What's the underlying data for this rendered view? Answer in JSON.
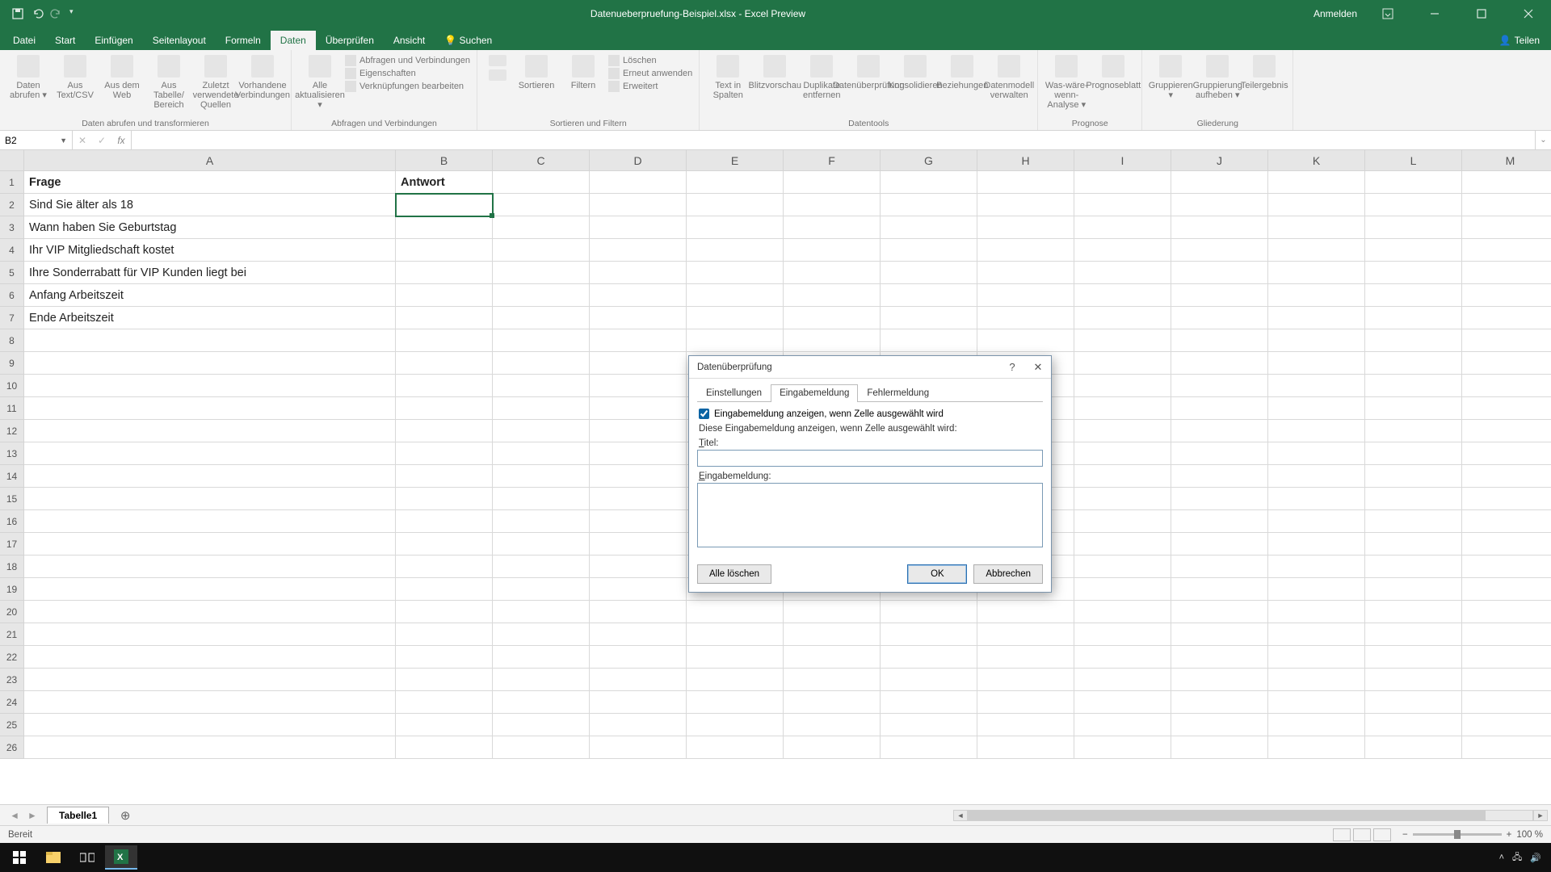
{
  "app": {
    "title": "Datenueberpruefung-Beispiel.xlsx - Excel Preview",
    "signin": "Anmelden"
  },
  "ribbon_tabs": [
    "Datei",
    "Start",
    "Einfügen",
    "Seitenlayout",
    "Formeln",
    "Daten",
    "Überprüfen",
    "Ansicht"
  ],
  "ribbon_search": "Suchen",
  "ribbon_share": "Teilen",
  "ribbon_active_tab": "Daten",
  "ribbon_groups": {
    "g1": {
      "label": "Daten abrufen und transformieren",
      "items": [
        "Daten abrufen ▾",
        "Aus Text/CSV",
        "Aus dem Web",
        "Aus Tabelle/ Bereich",
        "Zuletzt verwendete Quellen",
        "Vorhandene Verbindungen"
      ]
    },
    "g2": {
      "label": "Abfragen und Verbindungen",
      "big": "Alle aktualisieren ▾",
      "rows": [
        "Abfragen und Verbindungen",
        "Eigenschaften",
        "Verknüpfungen bearbeiten"
      ]
    },
    "g3": {
      "label": "Sortieren und Filtern",
      "items": [
        "Sortieren",
        "Filtern"
      ],
      "rows": [
        "Löschen",
        "Erneut anwenden",
        "Erweitert"
      ]
    },
    "g4": {
      "label": "Datentools",
      "items": [
        "Text in Spalten",
        "Blitzvorschau",
        "Duplikate entfernen",
        "Datenüberprüfung",
        "Konsolidieren",
        "Beziehungen",
        "Datenmodell verwalten"
      ]
    },
    "g5": {
      "label": "Prognose",
      "items": [
        "Was-wäre-wenn- Analyse ▾",
        "Prognoseblatt"
      ]
    },
    "g6": {
      "label": "Gliederung",
      "items": [
        "Gruppieren ▾",
        "Gruppierung aufheben ▾",
        "Teilergebnis"
      ]
    }
  },
  "namebox": "B2",
  "formula": "",
  "columns": [
    "A",
    "B",
    "C",
    "D",
    "E",
    "F",
    "G",
    "H",
    "I",
    "J",
    "K",
    "L",
    "M"
  ],
  "rows": {
    "1": {
      "A": "Frage",
      "B": "Antwort"
    },
    "2": {
      "A": "Sind Sie älter als 18"
    },
    "3": {
      "A": "Wann haben Sie Geburtstag"
    },
    "4": {
      "A": "Ihr VIP Mitgliedschaft kostet"
    },
    "5": {
      "A": "Ihre Sonderrabatt für VIP Kunden liegt bei"
    },
    "6": {
      "A": "Anfang Arbeitszeit"
    },
    "7": {
      "A": "Ende Arbeitszeit"
    }
  },
  "row_count": 26,
  "sheet_tab": "Tabelle1",
  "status": "Bereit",
  "zoom": "100 %",
  "dialog": {
    "title": "Datenüberprüfung",
    "tabs": [
      "Einstellungen",
      "Eingabemeldung",
      "Fehlermeldung"
    ],
    "active_tab": "Eingabemeldung",
    "checkbox": "Eingabemeldung anzeigen, wenn Zelle ausgewählt wird",
    "heading": "Diese Eingabemeldung anzeigen, wenn Zelle ausgewählt wird:",
    "label_title": "Titel:",
    "label_msg": "Eingabemeldung:",
    "clear": "Alle löschen",
    "ok": "OK",
    "cancel": "Abbrechen"
  }
}
